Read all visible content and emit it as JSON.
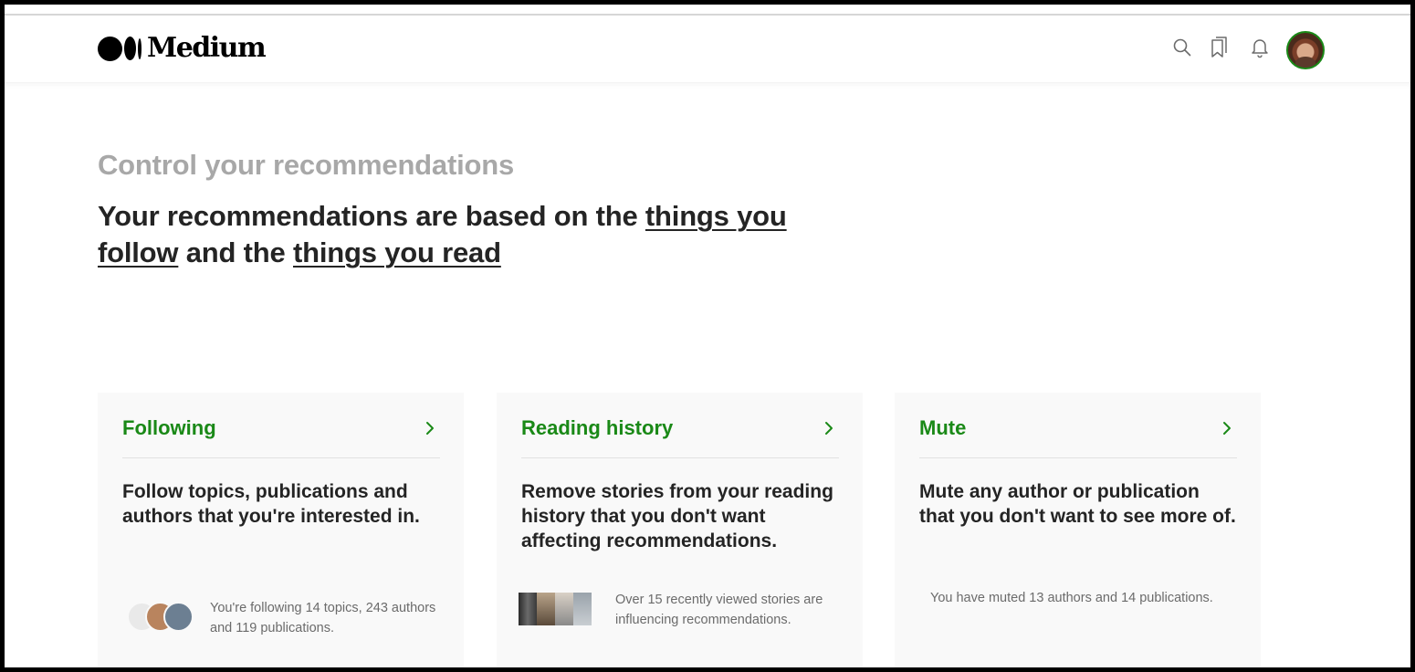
{
  "header": {
    "logo_text": "Medium",
    "icons": [
      "search-icon",
      "bookmarks-icon",
      "notifications-icon"
    ],
    "accent_color": "#1a8917"
  },
  "page": {
    "eyebrow": "Control your recommendations",
    "headline": {
      "part1": "Your recommendations are based on the ",
      "link1": "things you follow",
      "part2": " and the ",
      "link2": "things you read"
    }
  },
  "cards": [
    {
      "title": "Following",
      "description": "Follow topics, publications and authors that you're interested in.",
      "footer": "You're following 14 topics, 243 authors and 119 publications."
    },
    {
      "title": "Reading history",
      "description": "Remove stories from your reading history that you don't want affecting recommendations.",
      "footer": "Over 15 recently viewed stories are influencing recommendations."
    },
    {
      "title": "Mute",
      "description": "Mute any author or publication that you don't want to see more of.",
      "footer": "You have muted 13 authors and 14 publications."
    }
  ]
}
